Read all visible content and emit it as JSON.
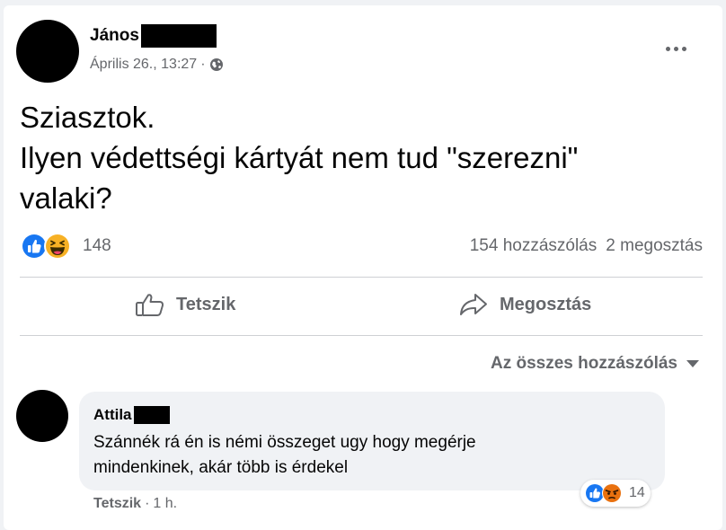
{
  "post": {
    "author": "János",
    "date": "Április 26., 13:27",
    "separator": "·",
    "text_lines": [
      "Sziasztok.",
      "Ilyen védettségi kártyát nem tud \"szerezni\"",
      "valaki?"
    ],
    "reactions": {
      "icons": [
        "like-icon",
        "haha-icon"
      ],
      "count": "148"
    },
    "comments_count": "154 hozzászólás",
    "shares_count": "2 megosztás"
  },
  "actions": {
    "like_label": "Tetszik",
    "share_label": "Megosztás"
  },
  "comments_filter": "Az összes hozzászólás",
  "comment": {
    "author": "Attila",
    "text_lines": [
      "Szánnék rá én is némi összeget ugy hogy megérje",
      "mindenkinek, akár több is érdekel"
    ],
    "like_label": "Tetszik",
    "separator": "·",
    "time": "1 h.",
    "reactions": {
      "icons": [
        "like-icon",
        "angry-icon"
      ],
      "count": "14"
    }
  },
  "colors": {
    "like_blue": "#1877f2",
    "haha_yellow": "#f7b125",
    "angry_orange": "#e9710f",
    "secondary_text": "#65676b",
    "bubble_bg": "#f0f2f5"
  }
}
